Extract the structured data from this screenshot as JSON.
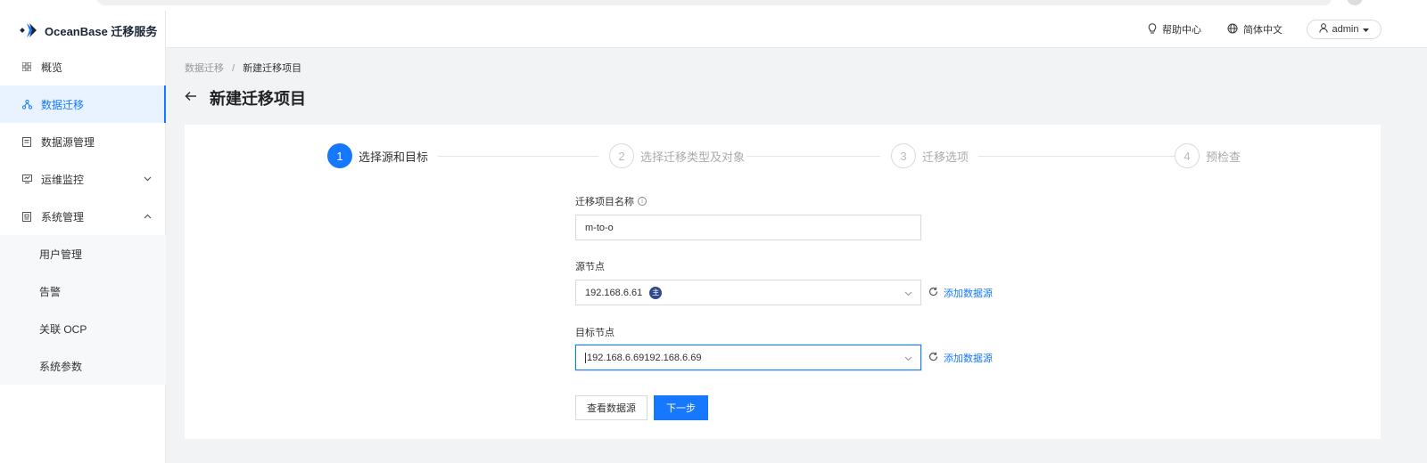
{
  "app": {
    "brand": "OceanBase 迁移服务"
  },
  "header": {
    "help": "帮助中心",
    "language": "简体中文",
    "user": "admin"
  },
  "sidebar": {
    "items": [
      {
        "label": "概览",
        "icon": "grid-icon"
      },
      {
        "label": "数据迁移",
        "icon": "migration-icon",
        "active": true
      },
      {
        "label": "数据源管理",
        "icon": "datasource-icon"
      },
      {
        "label": "运维监控",
        "icon": "monitor-icon",
        "chevron": "down"
      },
      {
        "label": "系统管理",
        "icon": "system-icon",
        "chevron": "up"
      }
    ],
    "subitems": [
      {
        "label": "用户管理"
      },
      {
        "label": "告警"
      },
      {
        "label": "关联 OCP"
      },
      {
        "label": "系统参数"
      }
    ]
  },
  "breadcrumb": {
    "parent": "数据迁移",
    "separator": "/",
    "current": "新建迁移项目"
  },
  "page": {
    "title": "新建迁移项目"
  },
  "steps": [
    {
      "num": "1",
      "label": "选择源和目标",
      "active": true
    },
    {
      "num": "2",
      "label": "选择迁移类型及对象"
    },
    {
      "num": "3",
      "label": "迁移选项"
    },
    {
      "num": "4",
      "label": "预检查"
    }
  ],
  "form": {
    "name_label": "迁移项目名称",
    "name_value": "m-to-o",
    "source_label": "源节点",
    "source_value": "192.168.6.61",
    "source_badge": "主",
    "target_label": "目标节点",
    "target_value": "192.168.6.69192.168.6.69",
    "add_source_link": "添加数据源",
    "add_target_link": "添加数据源",
    "view_button": "查看数据源",
    "next_button": "下一步"
  },
  "colors": {
    "primary": "#1677ff",
    "active_bg": "#e8f3ff",
    "badge": "#2f4a8a"
  }
}
